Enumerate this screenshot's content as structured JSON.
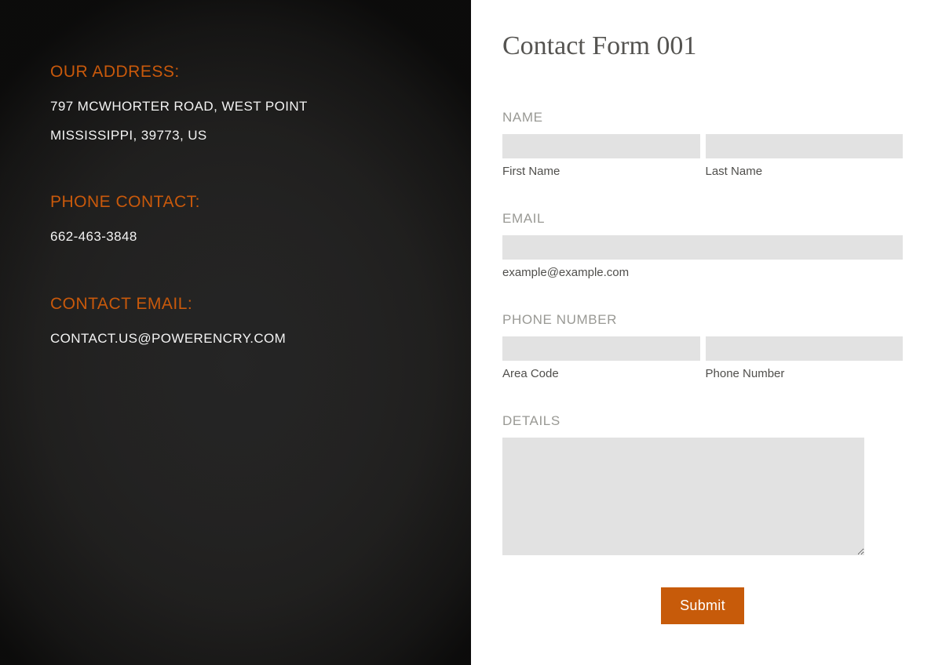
{
  "info": {
    "address": {
      "title": "OUR ADDRESS:",
      "line1": "797 MCWHORTER ROAD, WEST POINT",
      "line2": "MISSISSIPPI, 39773, US"
    },
    "phone": {
      "title": "PHONE CONTACT:",
      "value": "662-463-3848"
    },
    "email": {
      "title": "CONTACT EMAIL:",
      "value": "CONTACT.US@POWERENCRY.COM"
    }
  },
  "form": {
    "title": "Contact Form 001",
    "name": {
      "label": "NAME",
      "first_sub": "First Name",
      "last_sub": "Last Name"
    },
    "email": {
      "label": "EMAIL",
      "sub": "example@example.com"
    },
    "phone": {
      "label": "PHONE NUMBER",
      "area_sub": "Area Code",
      "num_sub": "Phone Number"
    },
    "details": {
      "label": "DETAILS"
    },
    "submit_label": "Submit"
  }
}
